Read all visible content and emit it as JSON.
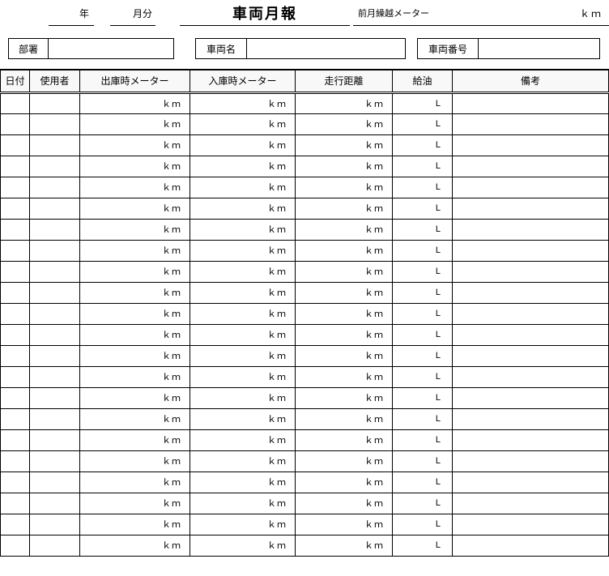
{
  "header": {
    "year_suffix": "年",
    "month_suffix": "月分",
    "title": "車両月報",
    "prev_month_label": "前月繰越メーター",
    "prev_month_unit": "ｋｍ"
  },
  "meta": {
    "dept_label": "部署",
    "dept_value": "",
    "vehicle_name_label": "車両名",
    "vehicle_name_value": "",
    "vehicle_number_label": "車両番号",
    "vehicle_number_value": ""
  },
  "columns": {
    "date": "日付",
    "user": "使用者",
    "meter_out": "出庫時メーター",
    "meter_in": "入庫時メーター",
    "distance": "走行距離",
    "fuel": "給油",
    "note": "備考"
  },
  "units": {
    "km": "ｋｍ",
    "liter": "L"
  },
  "row_count": 22
}
